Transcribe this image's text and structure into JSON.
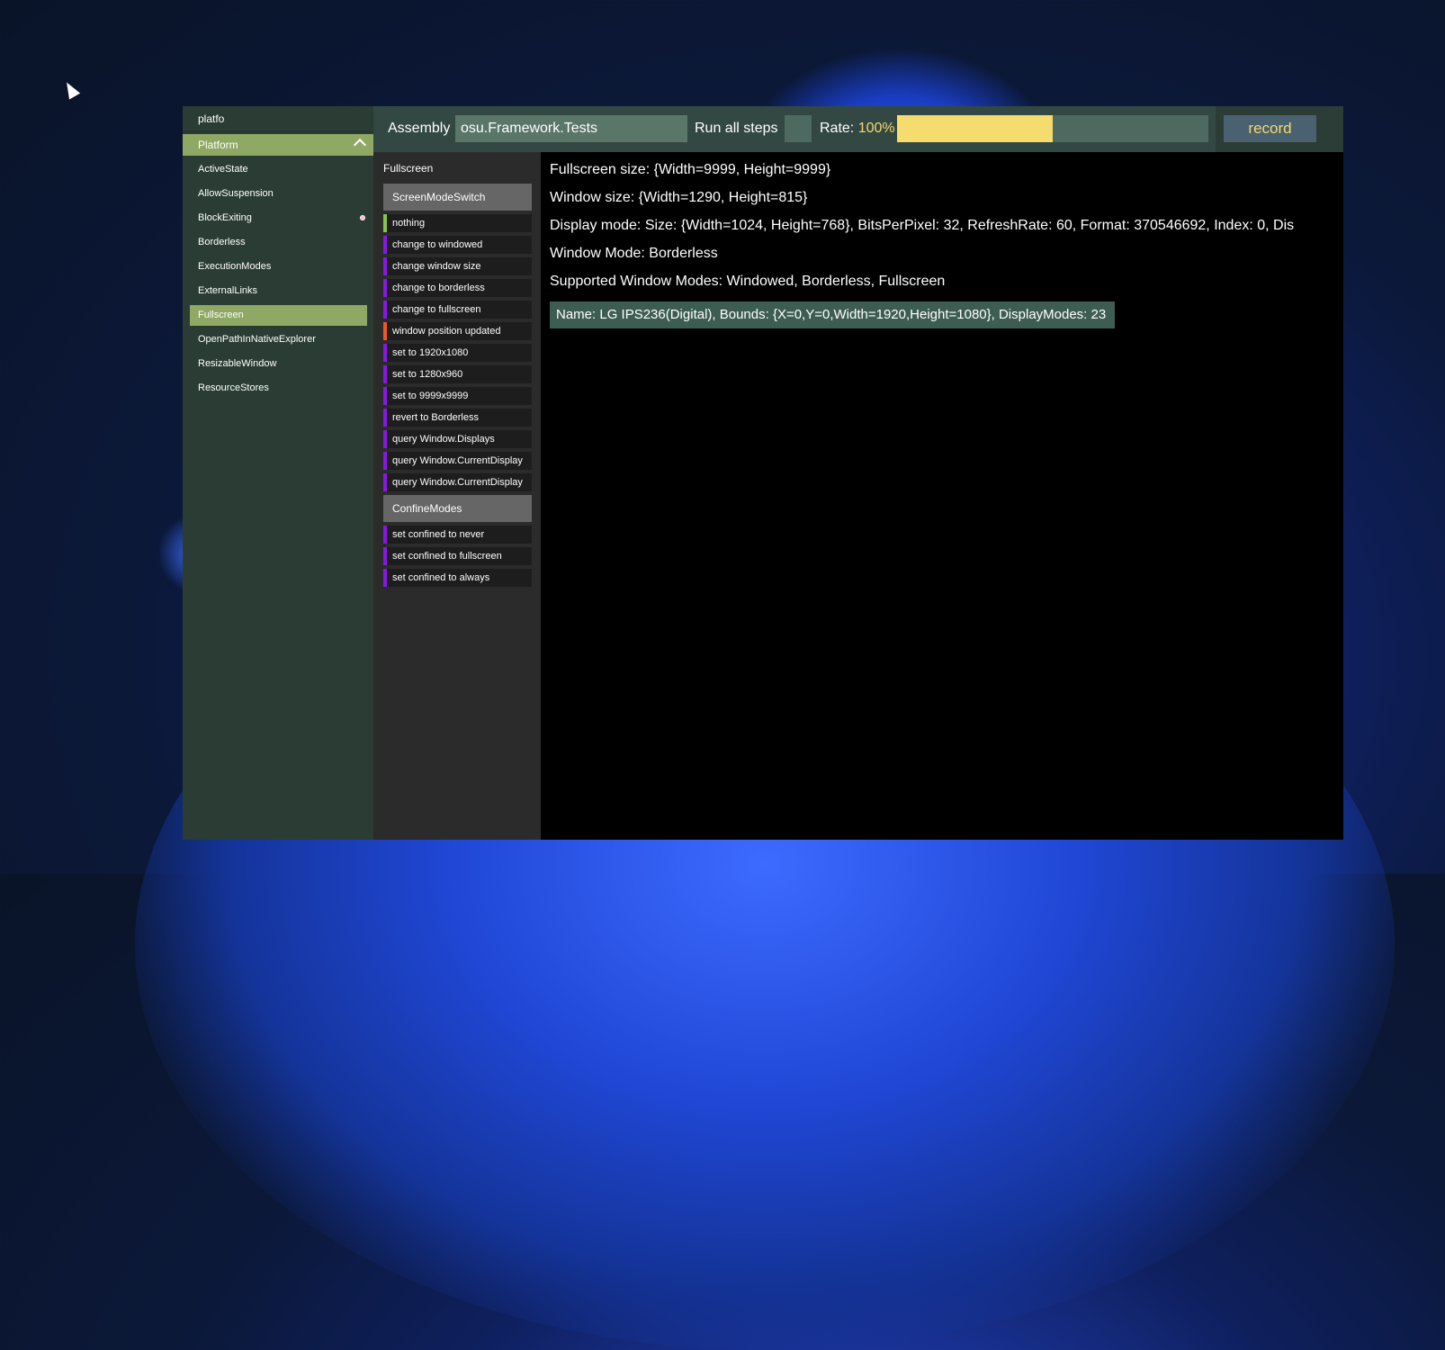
{
  "sidebar": {
    "search_text": "platfo",
    "group": "Platform",
    "items": [
      {
        "label": "ActiveState",
        "selected": false
      },
      {
        "label": "AllowSuspension",
        "selected": false
      },
      {
        "label": "BlockExiting",
        "selected": false,
        "indicator": true
      },
      {
        "label": "Borderless",
        "selected": false
      },
      {
        "label": "ExecutionModes",
        "selected": false
      },
      {
        "label": "ExternalLinks",
        "selected": false
      },
      {
        "label": "Fullscreen",
        "selected": true
      },
      {
        "label": "OpenPathInNativeExplorer",
        "selected": false
      },
      {
        "label": "ResizableWindow",
        "selected": false
      },
      {
        "label": "ResourceStores",
        "selected": false
      }
    ]
  },
  "toolbar": {
    "assembly_label": "Assembly",
    "assembly_value": "osu.Framework.Tests",
    "run_all_label": "Run all steps",
    "rate_label": "Rate:",
    "rate_value": "100%",
    "rate_fill_fraction": 0.5,
    "record_label": "record"
  },
  "steps": {
    "title": "Fullscreen",
    "groups": [
      {
        "label": "ScreenModeSwitch",
        "items": [
          {
            "label": "nothing",
            "color": "#8bc34a"
          },
          {
            "label": "change to windowed",
            "color": "#8a16e6"
          },
          {
            "label": "change window size",
            "color": "#8a16e6"
          },
          {
            "label": "change to borderless",
            "color": "#8a16e6"
          },
          {
            "label": "change to fullscreen",
            "color": "#8a16e6"
          },
          {
            "label": "window position updated",
            "color": "#f2571c"
          },
          {
            "label": "set to 1920x1080",
            "color": "#8a16e6"
          },
          {
            "label": "set to 1280x960",
            "color": "#8a16e6"
          },
          {
            "label": "set to 9999x9999",
            "color": "#8a16e6"
          },
          {
            "label": "revert to Borderless",
            "color": "#8a16e6"
          },
          {
            "label": "query Window.Displays",
            "color": "#8a16e6"
          },
          {
            "label": "query Window.CurrentDisplay",
            "color": "#8a16e6"
          },
          {
            "label": "query Window.CurrentDisplay",
            "color": "#8a16e6"
          }
        ]
      },
      {
        "label": "ConfineModes",
        "items": [
          {
            "label": "set confined to never",
            "color": "#8a16e6"
          },
          {
            "label": "set confined to fullscreen",
            "color": "#8a16e6"
          },
          {
            "label": "set confined to always",
            "color": "#8a16e6"
          }
        ]
      }
    ]
  },
  "content": {
    "lines": [
      "Fullscreen size: {Width=9999, Height=9999}",
      "Window size: {Width=1290, Height=815}",
      "Display mode: Size: {Width=1024, Height=768}, BitsPerPixel: 32, RefreshRate: 60, Format: 370546692, Index: 0, Dis",
      "Window Mode: Borderless",
      "Supported Window Modes: Windowed, Borderless, Fullscreen"
    ],
    "display_item": "Name: LG IPS236(Digital), Bounds: {X=0,Y=0,Width=1920,Height=1080}, DisplayModes: 23"
  }
}
